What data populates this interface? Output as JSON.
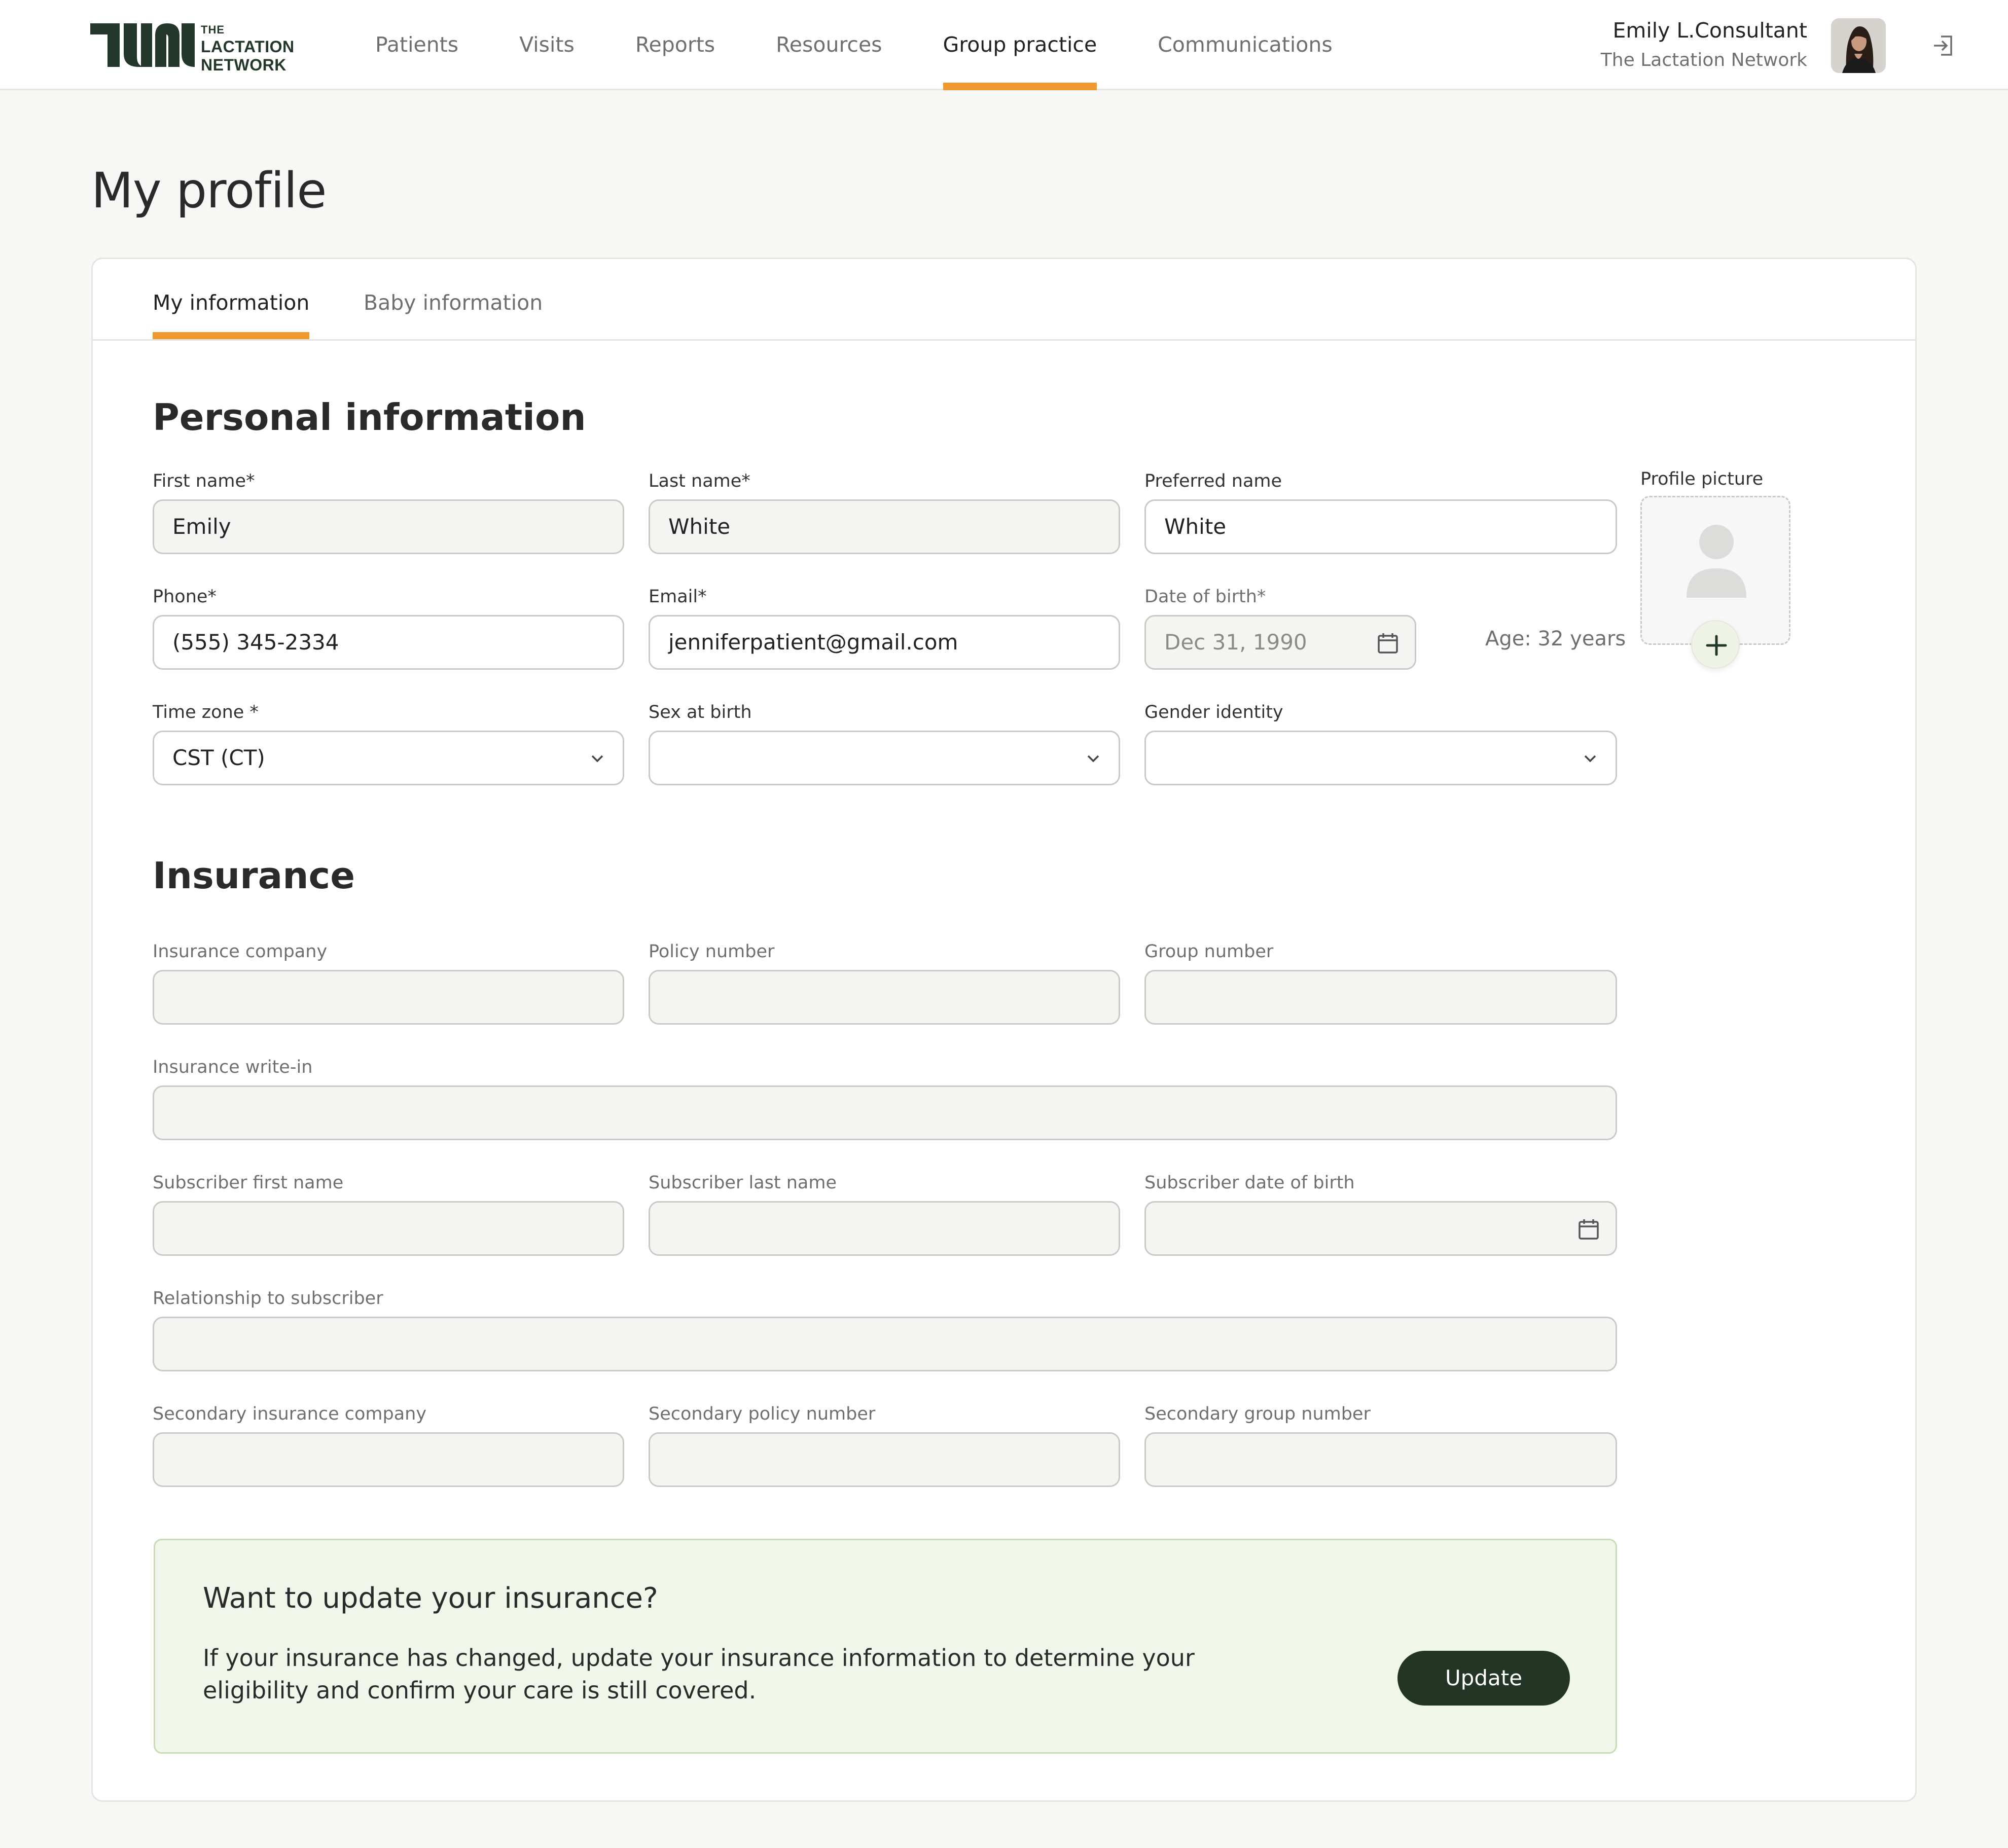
{
  "brand": {
    "line1": "THE",
    "line2": "LACTATION",
    "line3": "NETWORK",
    "color": "#23382a",
    "accent": "#f0992f"
  },
  "nav": {
    "items": [
      {
        "label": "Patients"
      },
      {
        "label": "Visits"
      },
      {
        "label": "Reports"
      },
      {
        "label": "Resources"
      },
      {
        "label": "Group practice",
        "active": true
      },
      {
        "label": "Communications"
      }
    ]
  },
  "user": {
    "name": "Emily L.Consultant",
    "org": "The Lactation Network"
  },
  "page": {
    "title": "My profile"
  },
  "tabs": [
    {
      "label": "My information",
      "active": true
    },
    {
      "label": "Baby information"
    }
  ],
  "personal": {
    "title": "Personal information",
    "first_name": {
      "label": "First name*",
      "value": "Emily"
    },
    "last_name": {
      "label": "Last name*",
      "value": "White"
    },
    "preferred_name": {
      "label": "Preferred name",
      "value": "White"
    },
    "phone": {
      "label": "Phone*",
      "value": "(555) 345-2334"
    },
    "email": {
      "label": "Email*",
      "value": "jenniferpatient@gmail.com"
    },
    "dob": {
      "label": "Date of birth*",
      "value": "Dec 31, 1990"
    },
    "age": "Age: 32 years",
    "time_zone": {
      "label": "Time zone *",
      "value": "CST (CT)"
    },
    "sex_at_birth": {
      "label": "Sex at birth",
      "value": ""
    },
    "gender_identity": {
      "label": "Gender identity",
      "value": ""
    },
    "profile_picture": {
      "label": "Profile picture"
    }
  },
  "insurance": {
    "title": "Insurance",
    "company": {
      "label": "Insurance company"
    },
    "policy_number": {
      "label": "Policy number"
    },
    "group_number": {
      "label": "Group number"
    },
    "write_in": {
      "label": "Insurance write-in"
    },
    "subscriber_first": {
      "label": "Subscriber first name"
    },
    "subscriber_last": {
      "label": "Subscriber last name"
    },
    "subscriber_dob": {
      "label": "Subscriber date of birth"
    },
    "relationship": {
      "label": "Relationship to subscriber"
    },
    "secondary_company": {
      "label": "Secondary insurance company"
    },
    "secondary_policy": {
      "label": "Secondary policy number"
    },
    "secondary_group": {
      "label": "Secondary group number"
    }
  },
  "banner": {
    "title": "Want to update your insurance?",
    "text": "If your insurance has changed, update your insurance information to determine your eligibility and confirm your care is still covered.",
    "button": "Update"
  }
}
